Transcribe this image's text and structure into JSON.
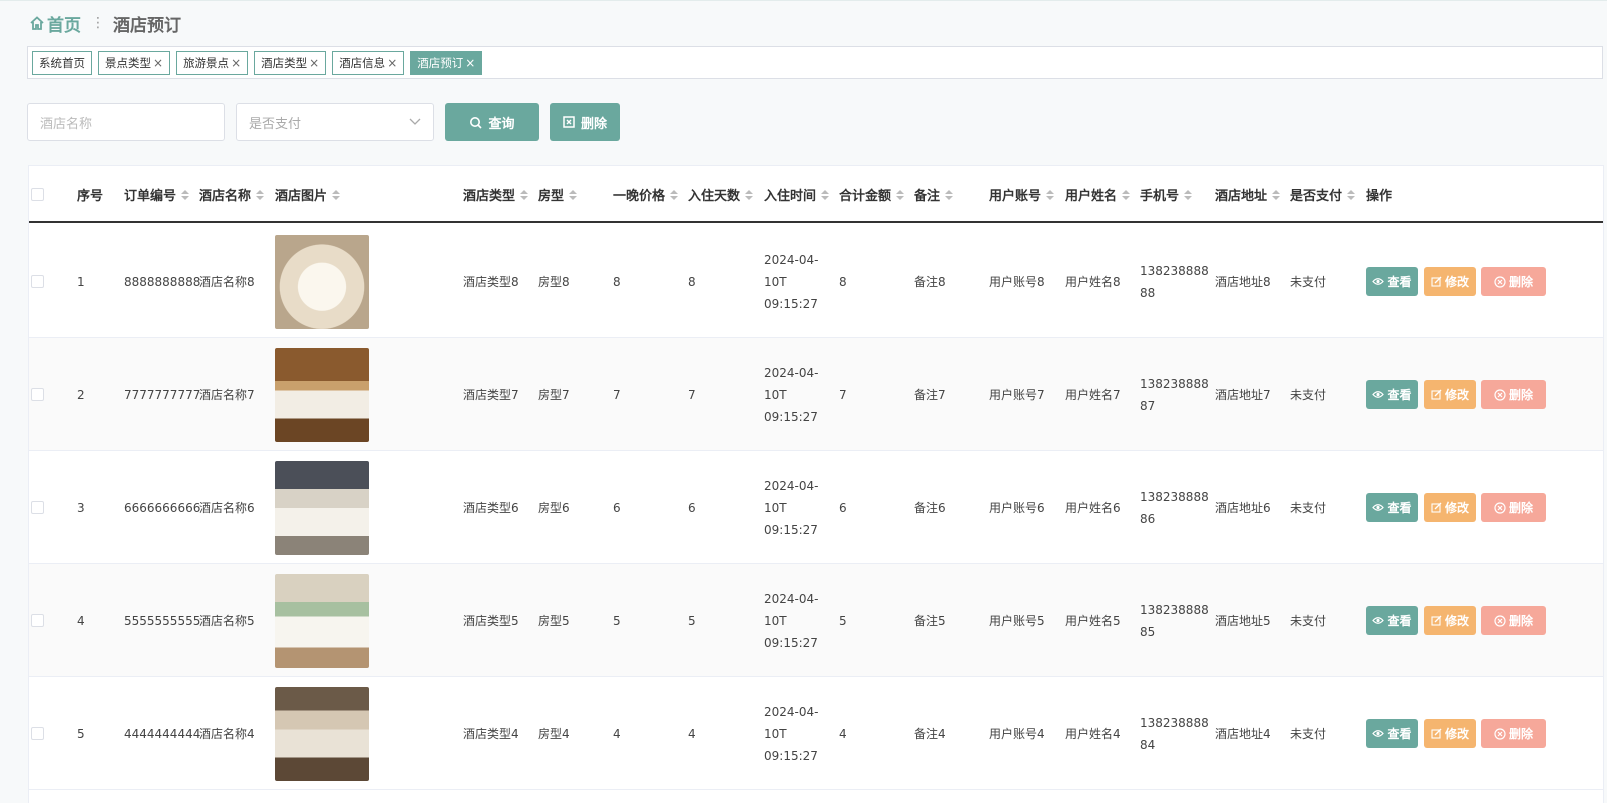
{
  "breadcrumb": {
    "home": "首页",
    "separator": "⋮",
    "current": "酒店预订"
  },
  "tabs": [
    {
      "label": "系统首页",
      "closable": false
    },
    {
      "label": "景点类型",
      "closable": true
    },
    {
      "label": "旅游景点",
      "closable": true
    },
    {
      "label": "酒店类型",
      "closable": true
    },
    {
      "label": "酒店信息",
      "closable": true
    },
    {
      "label": "酒店预订",
      "closable": true,
      "active": true
    }
  ],
  "search": {
    "hotel_name_placeholder": "酒店名称",
    "paid_placeholder": "是否支付",
    "query_label": "查询",
    "delete_label": "删除"
  },
  "table": {
    "headers": {
      "index": "序号",
      "order_no": "订单编号",
      "hotel_name": "酒店名称",
      "hotel_image": "酒店图片",
      "hotel_type": "酒店类型",
      "room_type": "房型",
      "night_price": "一晚价格",
      "days": "入住天数",
      "checkin_time": "入住时间",
      "total": "合计金额",
      "remark": "备注",
      "account": "用户账号",
      "user_name": "用户姓名",
      "phone": "手机号",
      "address": "酒店地址",
      "paid": "是否支付",
      "ops": "操作"
    },
    "actions": {
      "view": "查看",
      "edit": "修改",
      "delete": "删除"
    },
    "rows": [
      {
        "index": "1",
        "order_no": "8888888888",
        "hotel_name": "酒店名称8",
        "hotel_type": "酒店类型8",
        "room_type": "房型8",
        "night_price": "8",
        "days": "8",
        "checkin_time": "2024-04-10T 09:15:27",
        "total": "8",
        "remark": "备注8",
        "account": "用户账号8",
        "user_name": "用户姓名8",
        "phone": "13823888888",
        "address": "酒店地址8",
        "paid": "未支付"
      },
      {
        "index": "2",
        "order_no": "7777777777",
        "hotel_name": "酒店名称7",
        "hotel_type": "酒店类型7",
        "room_type": "房型7",
        "night_price": "7",
        "days": "7",
        "checkin_time": "2024-04-10T 09:15:27",
        "total": "7",
        "remark": "备注7",
        "account": "用户账号7",
        "user_name": "用户姓名7",
        "phone": "13823888887",
        "address": "酒店地址7",
        "paid": "未支付"
      },
      {
        "index": "3",
        "order_no": "6666666666",
        "hotel_name": "酒店名称6",
        "hotel_type": "酒店类型6",
        "room_type": "房型6",
        "night_price": "6",
        "days": "6",
        "checkin_time": "2024-04-10T 09:15:27",
        "total": "6",
        "remark": "备注6",
        "account": "用户账号6",
        "user_name": "用户姓名6",
        "phone": "13823888886",
        "address": "酒店地址6",
        "paid": "未支付"
      },
      {
        "index": "4",
        "order_no": "5555555555",
        "hotel_name": "酒店名称5",
        "hotel_type": "酒店类型5",
        "room_type": "房型5",
        "night_price": "5",
        "days": "5",
        "checkin_time": "2024-04-10T 09:15:27",
        "total": "5",
        "remark": "备注5",
        "account": "用户账号5",
        "user_name": "用户姓名5",
        "phone": "13823888885",
        "address": "酒店地址5",
        "paid": "未支付"
      },
      {
        "index": "5",
        "order_no": "4444444444",
        "hotel_name": "酒店名称4",
        "hotel_type": "酒店类型4",
        "room_type": "房型4",
        "night_price": "4",
        "days": "4",
        "checkin_time": "2024-04-10T 09:15:27",
        "total": "4",
        "remark": "备注4",
        "account": "用户账号4",
        "user_name": "用户姓名4",
        "phone": "13823888884",
        "address": "酒店地址4",
        "paid": "未支付"
      }
    ]
  },
  "colors": {
    "accent": "#6aa89e",
    "edit": "#f5b56f",
    "delete": "#f6a89a"
  }
}
